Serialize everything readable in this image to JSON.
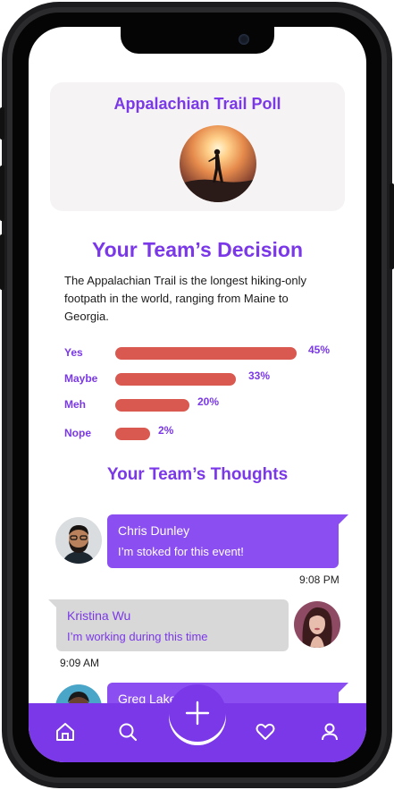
{
  "poll": {
    "title": "Appalachian Trail Poll",
    "photo": "hiker-at-sunset-photo"
  },
  "decision": {
    "title": "Your Team’s Decision",
    "description": "The Appalachian Trail is the longest hiking-only footpath in the world, ranging from Maine to Georgia.",
    "options": [
      {
        "label": "Yes",
        "percent": "45%",
        "value": 45
      },
      {
        "label": "Maybe",
        "percent": "33%",
        "value": 33
      },
      {
        "label": "Meh",
        "percent": "20%",
        "value": 20
      },
      {
        "label": "Nope",
        "percent": "2%",
        "value": 2
      }
    ]
  },
  "thoughts": {
    "title": "Your Team’s Thoughts",
    "comments": [
      {
        "name": "Chris Dunley",
        "message": "I’m stoked for this event!",
        "time": "9:08 PM"
      },
      {
        "name": "Kristina Wu",
        "message": "I’m working during this time",
        "time": "9:09 AM"
      },
      {
        "name": "Greg Lake",
        "message": ""
      }
    ]
  },
  "nav": {
    "items": [
      "home-icon",
      "search-icon",
      "plus-icon",
      "heart-icon",
      "user-icon"
    ]
  },
  "colors": {
    "accent": "#7a38e8",
    "bar": "#d9584f",
    "bubble_own": "#8b4ef0",
    "bubble_other": "#d9d8d8"
  }
}
